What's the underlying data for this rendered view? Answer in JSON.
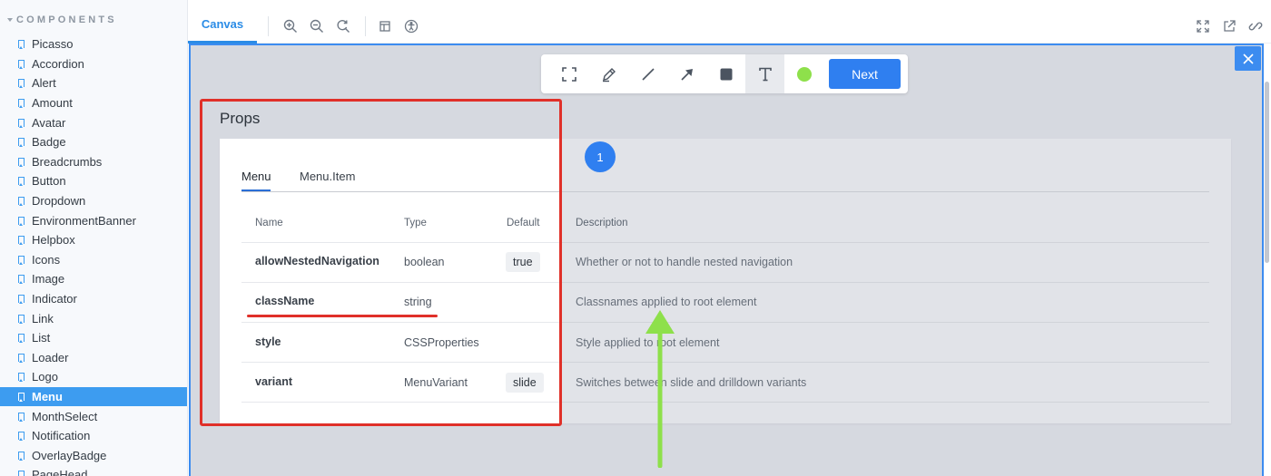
{
  "sidebar": {
    "section_title": "COMPONENTS",
    "items": [
      {
        "label": "Picasso"
      },
      {
        "label": "Accordion"
      },
      {
        "label": "Alert"
      },
      {
        "label": "Amount"
      },
      {
        "label": "Avatar"
      },
      {
        "label": "Badge"
      },
      {
        "label": "Breadcrumbs"
      },
      {
        "label": "Button"
      },
      {
        "label": "Dropdown"
      },
      {
        "label": "EnvironmentBanner"
      },
      {
        "label": "Helpbox"
      },
      {
        "label": "Icons"
      },
      {
        "label": "Image"
      },
      {
        "label": "Indicator"
      },
      {
        "label": "Link"
      },
      {
        "label": "List"
      },
      {
        "label": "Loader"
      },
      {
        "label": "Logo"
      },
      {
        "label": "Menu",
        "active": true
      },
      {
        "label": "MonthSelect"
      },
      {
        "label": "Notification"
      },
      {
        "label": "OverlayBadge"
      },
      {
        "label": "PageHead"
      }
    ]
  },
  "toolbar": {
    "active_tab": "Canvas",
    "icons": [
      "zoom-in-icon",
      "zoom-out-icon",
      "reset-zoom-icon",
      "grid-icon",
      "accessibility-icon",
      "fullscreen-icon",
      "open-new-tab-icon",
      "copy-link-icon"
    ]
  },
  "annotation_toolbar": {
    "tools": [
      "crop-icon",
      "pencil-icon",
      "line-icon",
      "arrow-icon",
      "rectangle-icon",
      "text-icon",
      "color-swatch"
    ],
    "active_tool": "text-icon",
    "selected_color": "#8ee04b",
    "next_label": "Next"
  },
  "props": {
    "title": "Props",
    "tabs": [
      "Menu",
      "Menu.Item"
    ],
    "active_tab": "Menu",
    "columns": [
      "Name",
      "Type",
      "Default",
      "Description"
    ],
    "rows": [
      {
        "name": "allowNestedNavigation",
        "type": "boolean",
        "default": "true",
        "description": "Whether or not to handle nested navigation"
      },
      {
        "name": "className",
        "type": "string",
        "default": "",
        "description": "Classnames applied to root element"
      },
      {
        "name": "style",
        "type": "CSSProperties",
        "default": "",
        "description": "Style applied to root element"
      },
      {
        "name": "variant",
        "type": "MenuVariant",
        "default": "slide",
        "description": "Switches between slide and drilldown variants"
      }
    ]
  },
  "step_badge": "1",
  "annotation_colors": {
    "red": "#e03029",
    "green": "#8ee04b",
    "accent": "#3c8cf0"
  }
}
